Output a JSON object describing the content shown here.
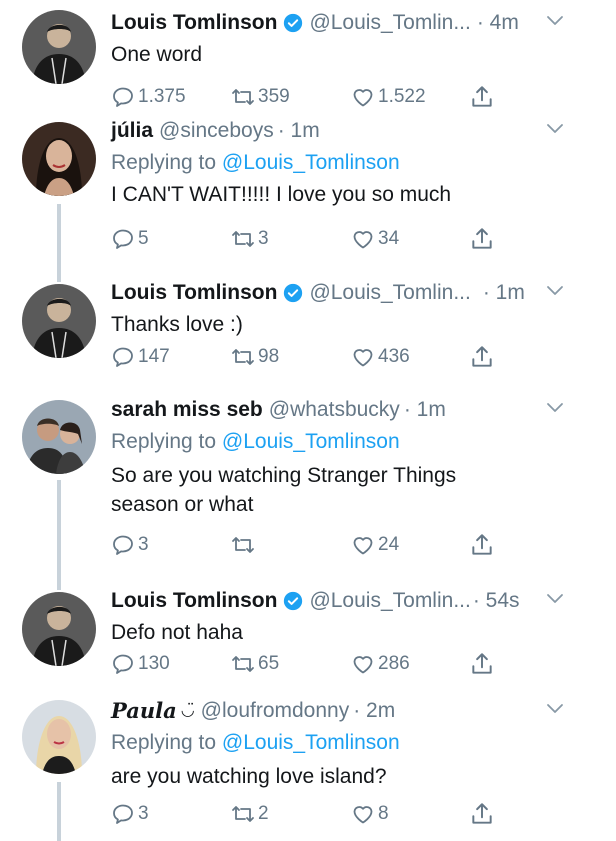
{
  "tweets": [
    {
      "name": "Louis Tomlinson",
      "verified": true,
      "handle": "@Louis_Tomlin...",
      "time": "· 4m",
      "replying_label": "",
      "replying_handle": "",
      "text": "One word",
      "replies": "1.375",
      "retweets": "359",
      "likes": "1.522"
    },
    {
      "name": "júlia",
      "verified": false,
      "handle": "@sinceboys",
      "time": "· 1m",
      "replying_label": "Replying to",
      "replying_handle": "@Louis_Tomlinson",
      "text": "I CAN'T WAIT!!!!! I love you so much",
      "replies": "5",
      "retweets": "3",
      "likes": "34"
    },
    {
      "name": "Louis Tomlinson",
      "verified": true,
      "handle": "@Louis_Tomlin...",
      "time": "· 1m",
      "replying_label": "",
      "replying_handle": "",
      "text": "Thanks love :)",
      "replies": "147",
      "retweets": "98",
      "likes": "436"
    },
    {
      "name": "sarah miss seb",
      "verified": false,
      "handle": "@whatsbucky",
      "time": "· 1m",
      "replying_label": "Replying to",
      "replying_handle": "@Louis_Tomlinson",
      "text_lines": [
        "So are you watching Stranger Things",
        "season or what"
      ],
      "replies": "3",
      "retweets": "",
      "likes": "24"
    },
    {
      "name": "Louis Tomlinson",
      "verified": true,
      "handle": "@Louis_Tomlin...",
      "time": "· 54s",
      "replying_label": "",
      "replying_handle": "",
      "text": "Defo not haha",
      "replies": "130",
      "retweets": "65",
      "likes": "286"
    },
    {
      "name": "Paula",
      "name_suffix": "◡̈",
      "verified": false,
      "handle": "@loufromdonny",
      "time": "· 2m",
      "replying_label": "Replying to",
      "replying_handle": "@Louis_Tomlinson",
      "text": "are you watching love island?",
      "replies": "3",
      "retweets": "2",
      "likes": "8"
    }
  ],
  "colors": {
    "link": "#1da1f2",
    "muted": "#657786",
    "verified": "#1da1f2",
    "thread": "#c8d2da"
  },
  "icons": {
    "reply": "reply-icon",
    "retweet": "retweet-icon",
    "like": "heart-icon",
    "share": "share-icon",
    "caret": "chevron-down-icon",
    "verified": "verified-badge-icon"
  }
}
